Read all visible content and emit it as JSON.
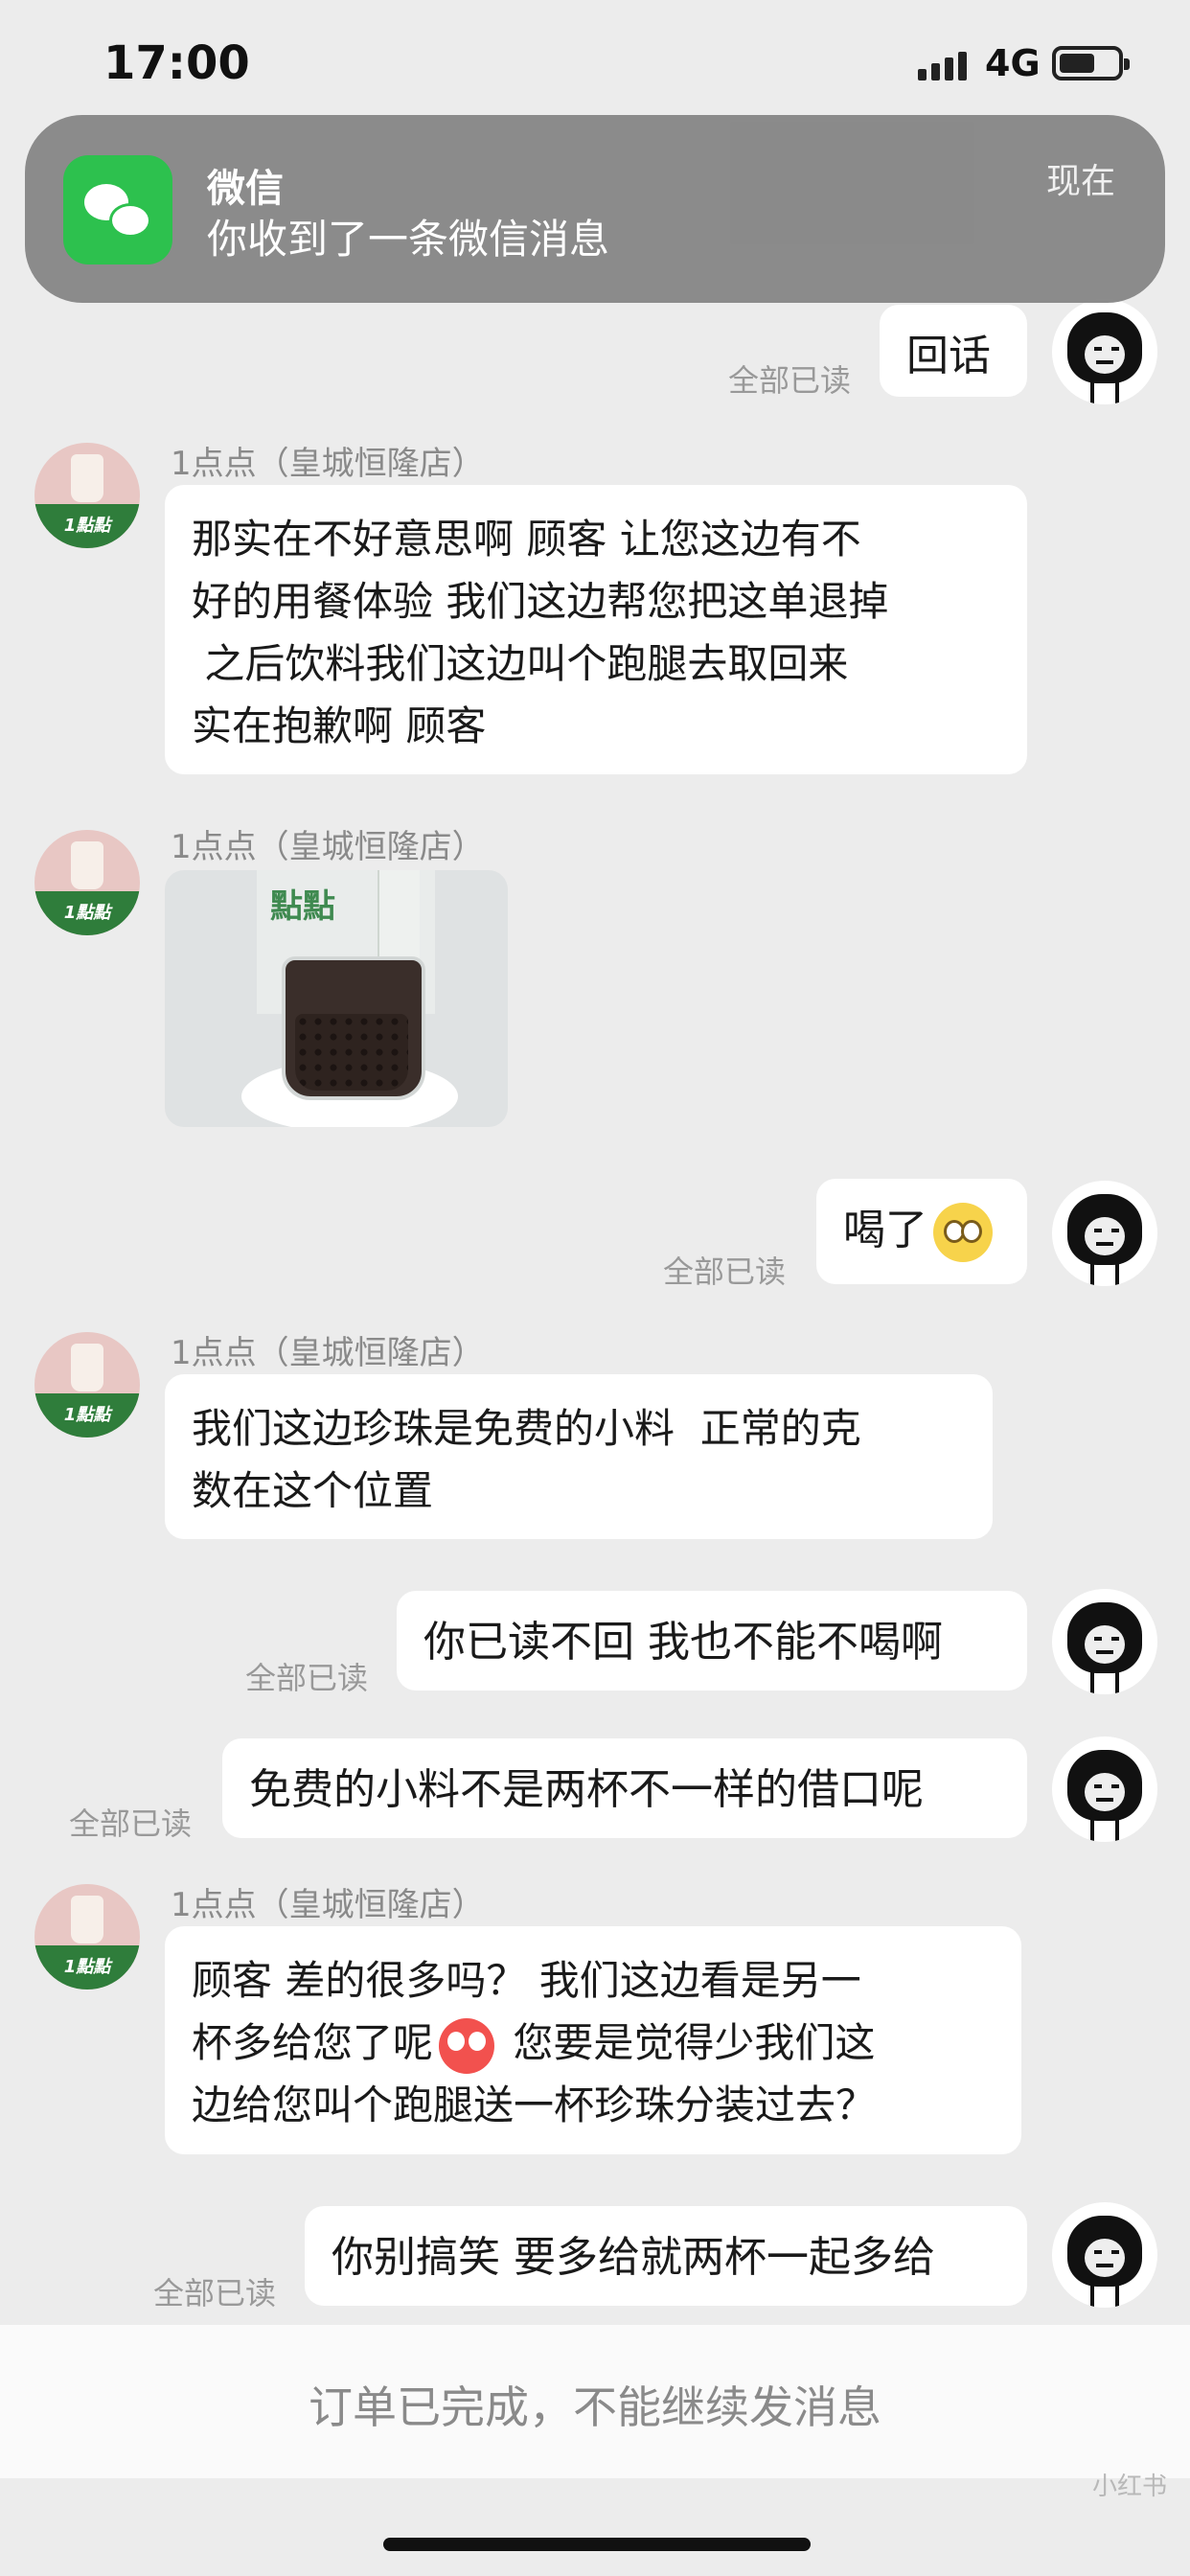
{
  "status_bar": {
    "time": "17:00",
    "network": "4G",
    "battery_level": 0.62
  },
  "notification": {
    "app_name": "微信",
    "message": "你收到了一条微信消息",
    "time": "现在",
    "icon": "wechat-icon"
  },
  "shop_name": "1点点（皇城恒隆店）",
  "avatar_shop_tag": "1點點",
  "read_label": "全部已读",
  "messages": [
    {
      "from": "me",
      "text": "回话",
      "read": "全部已读"
    },
    {
      "from": "shop",
      "sender": "1点点（皇城恒隆店）",
      "lines": [
        "那实在不好意思啊 顾客 让您这边有不",
        "好的用餐体验 我们这边帮您把这单退掉",
        " 之后饮料我们这边叫个跑腿去取回来",
        "实在抱歉啊 顾客"
      ]
    },
    {
      "from": "shop",
      "sender": "1点点（皇城恒隆店）",
      "image_text": "點點",
      "type": "image"
    },
    {
      "from": "me",
      "text": "喝了",
      "emoji": "smile-emoji",
      "read": "全部已读"
    },
    {
      "from": "shop",
      "sender": "1点点（皇城恒隆店）",
      "lines": [
        "我们这边珍珠是免费的小料  正常的克",
        "数在这个位置"
      ]
    },
    {
      "from": "me",
      "text": "你已读不回 我也不能不喝啊",
      "read": "全部已读"
    },
    {
      "from": "me",
      "text": "免费的小料不是两杯不一样的借口呢",
      "read": "全部已读"
    },
    {
      "from": "shop",
      "sender": "1点点（皇城恒隆店）",
      "line1": "顾客 差的很多吗？ 我们这边看是另一",
      "line2a": "杯多给您了呢",
      "line2b": " 您要是觉得少我们这",
      "line3": "边给您叫个跑腿送一杯珍珠分装过去？",
      "emoji": "eye-roll-emoji"
    },
    {
      "from": "me",
      "text": "你别搞笑 要多给就两杯一起多给",
      "read": "全部已读"
    }
  ],
  "footer": {
    "text": "订单已完成，不能继续发消息"
  },
  "watermark": "小红书"
}
